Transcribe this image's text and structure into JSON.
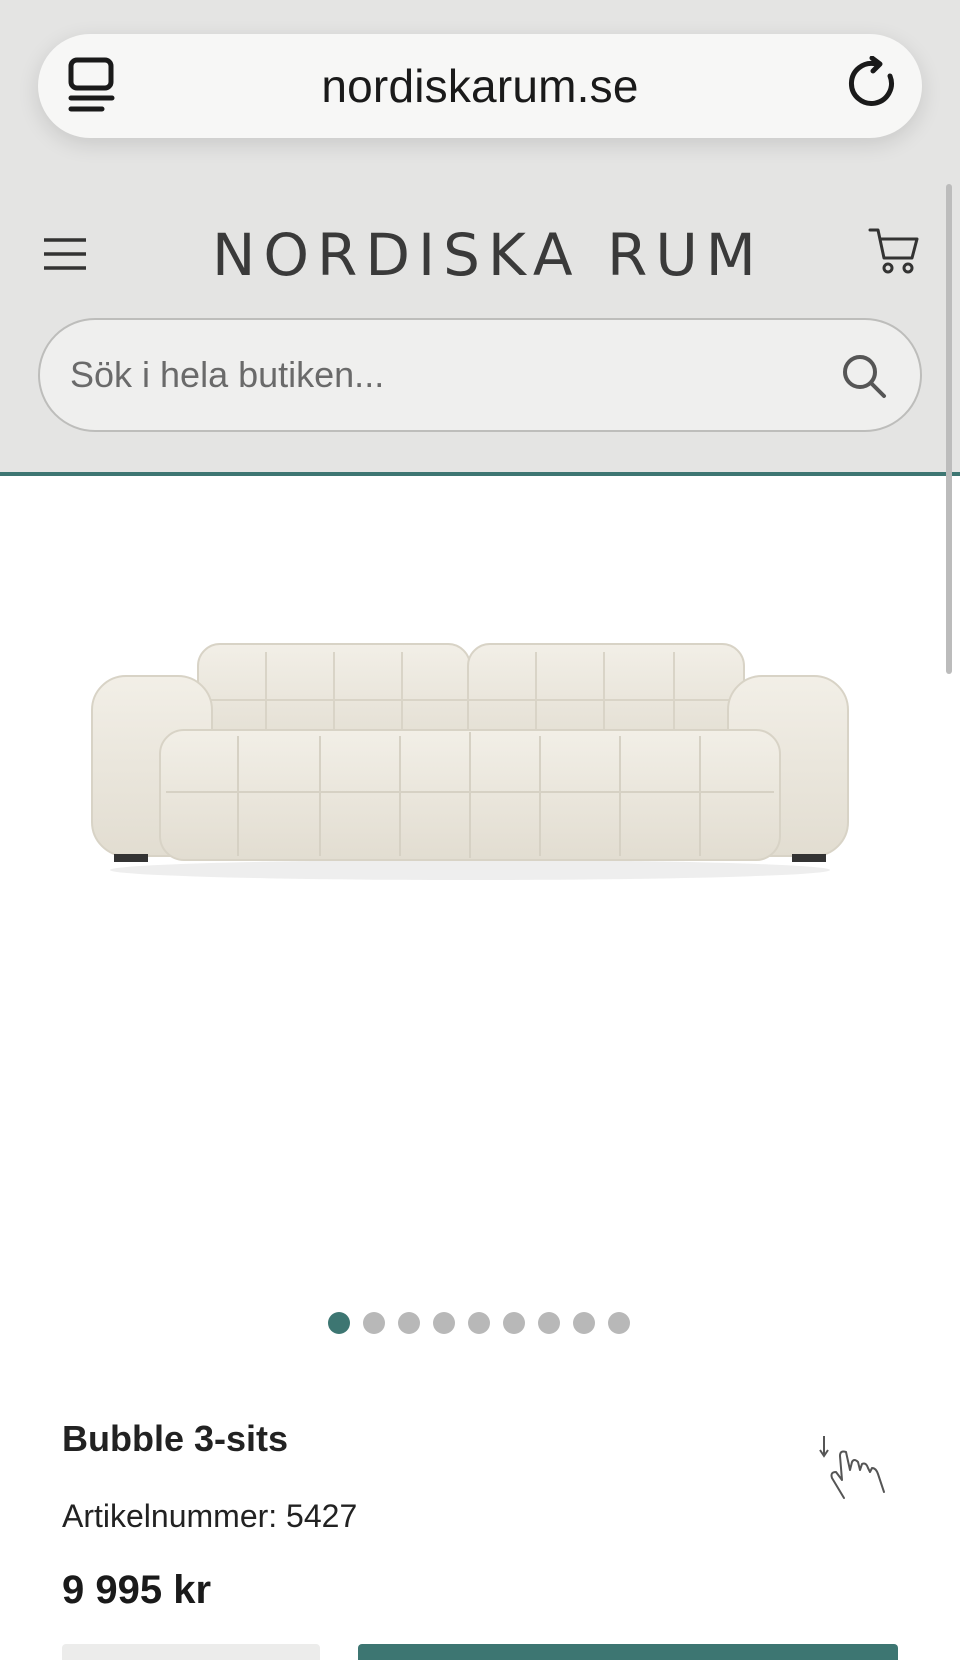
{
  "browser": {
    "url": "nordiskarum.se"
  },
  "header": {
    "logo_text": "NORDISKA RUM"
  },
  "search": {
    "placeholder": "Sök i hela butiken..."
  },
  "carousel": {
    "total_slides": 9,
    "active_index": 0
  },
  "product": {
    "name": "Bubble 3-sits",
    "article_label": "Artikelnummer: 5427",
    "price": "9 995 kr"
  },
  "colors": {
    "accent": "#3d7672",
    "header_bg": "#e4e4e3"
  },
  "icons": [
    "tabs-icon",
    "reload-icon",
    "menu-icon",
    "cart-icon",
    "search-icon",
    "scroll-hand-icon"
  ]
}
